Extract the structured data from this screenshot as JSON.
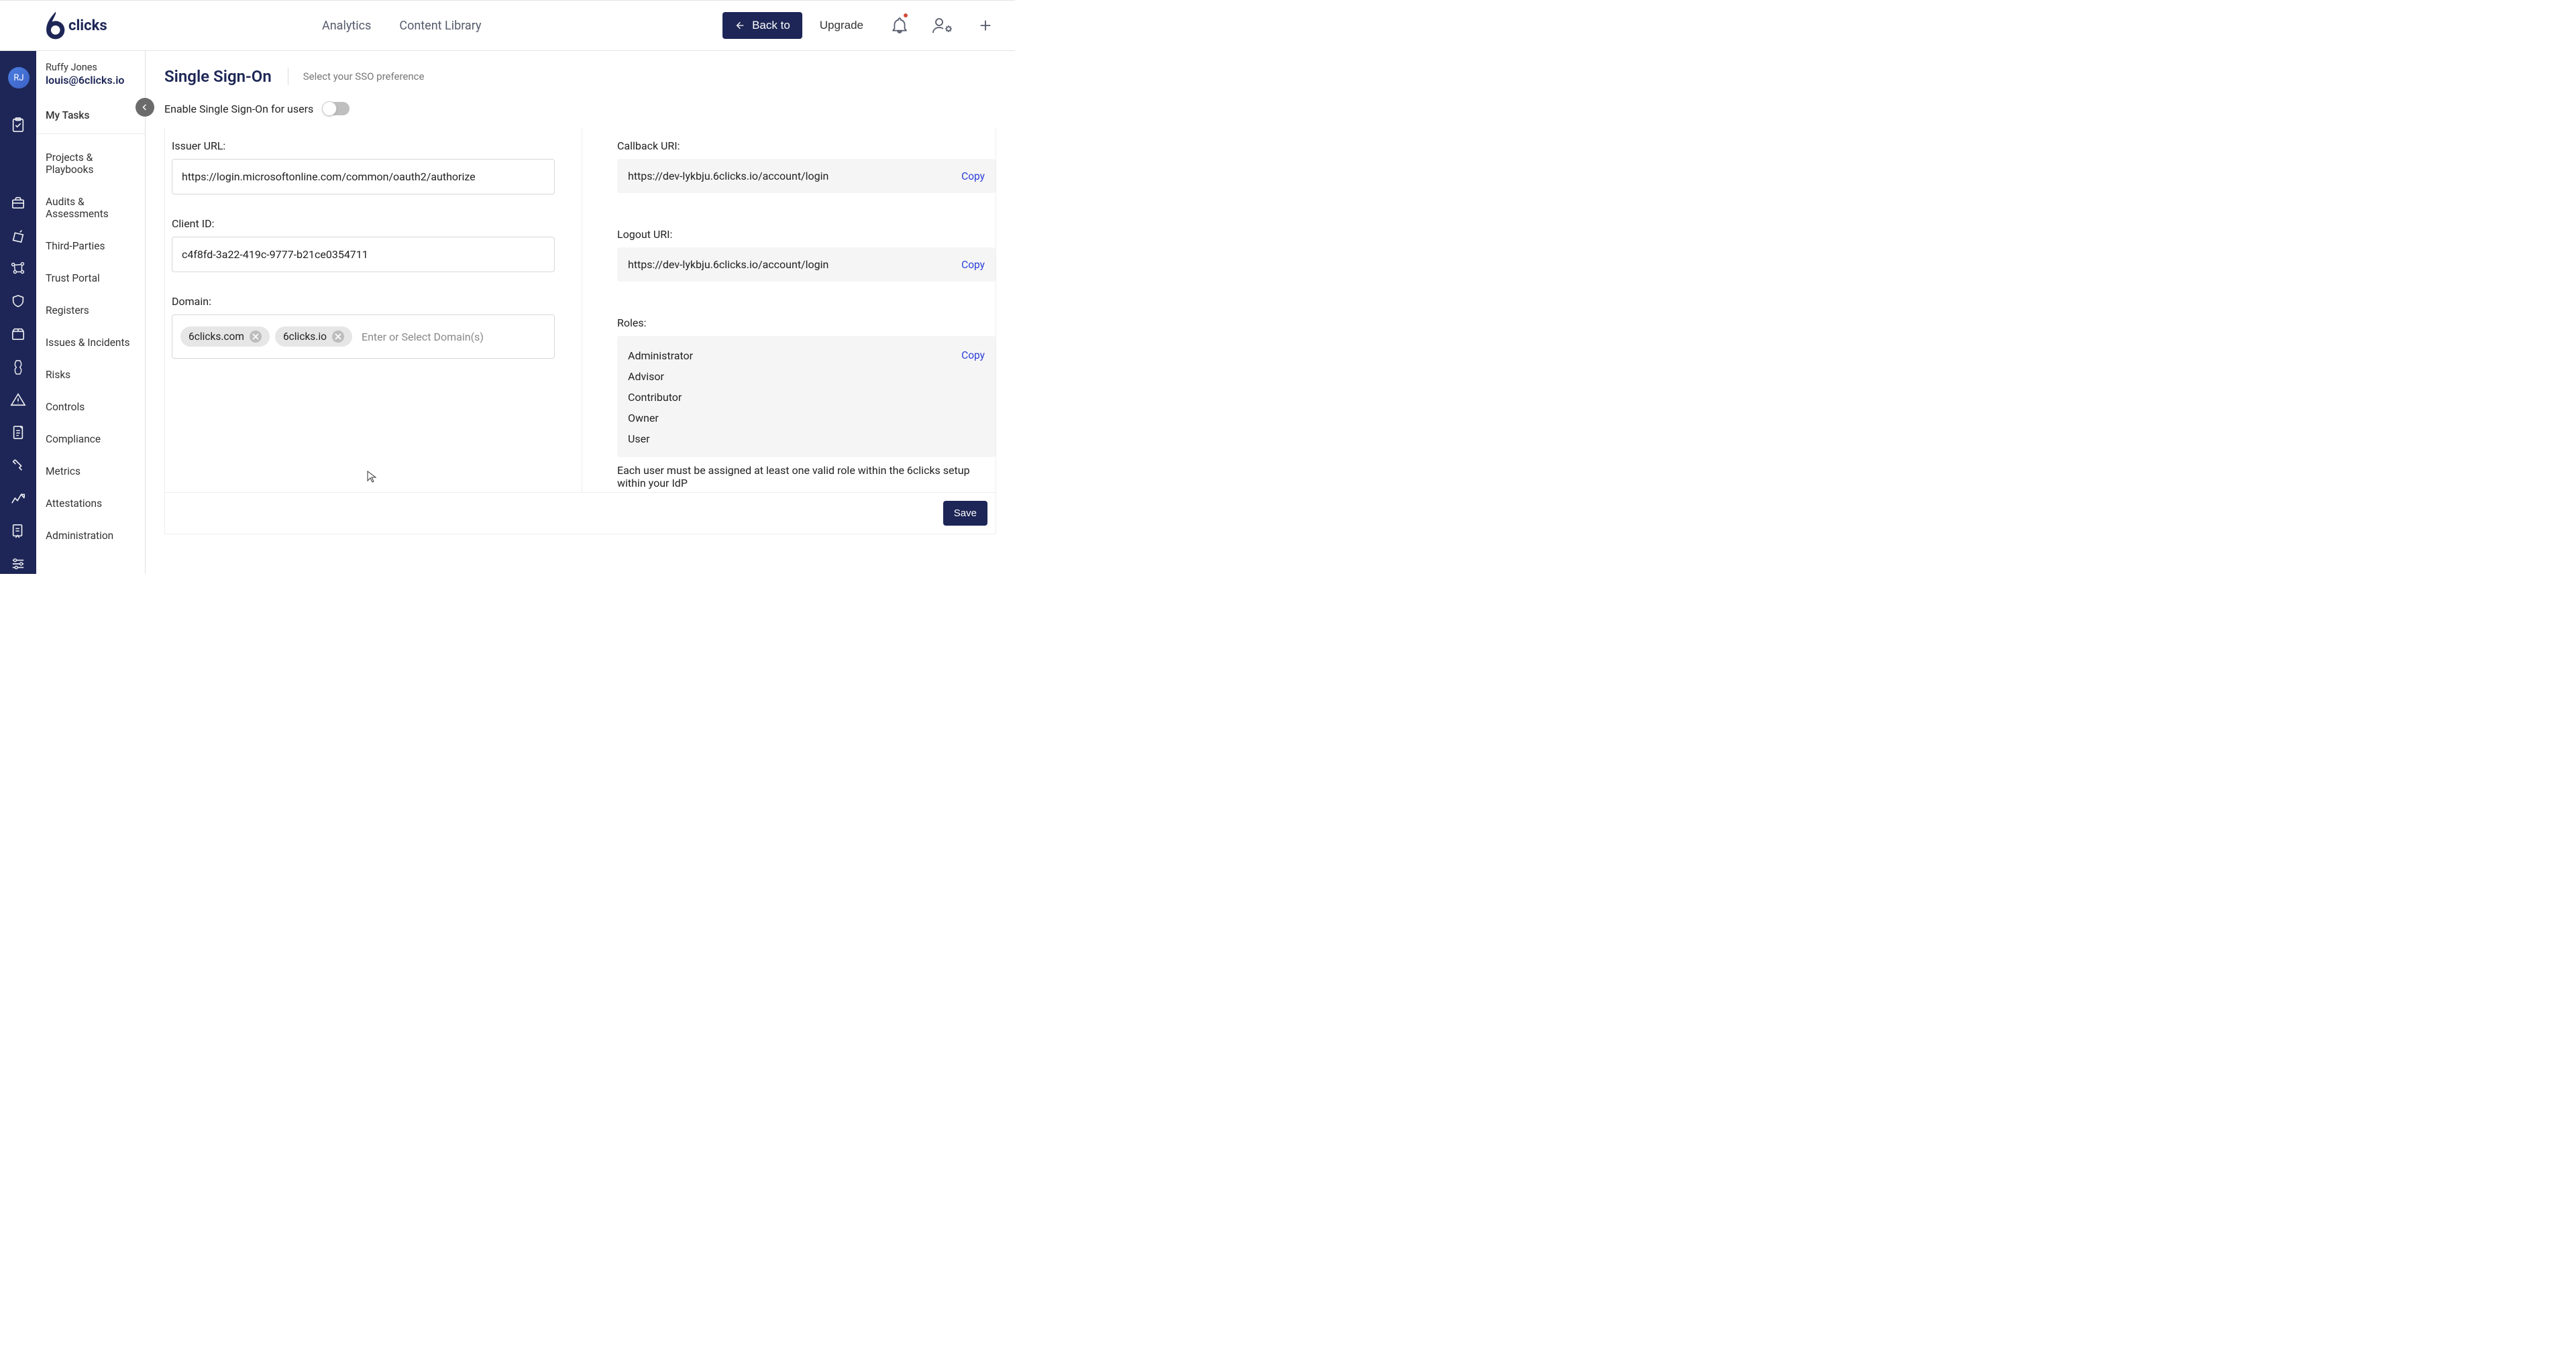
{
  "brand": "clicks",
  "topnav": {
    "analytics": "Analytics",
    "content_library": "Content Library"
  },
  "buttons": {
    "back": "Back to",
    "upgrade": "Upgrade",
    "save": "Save",
    "copy": "Copy"
  },
  "user": {
    "initials": "RJ",
    "name": "Ruffy Jones",
    "email": "louis@6clicks.io",
    "my_tasks": "My Tasks"
  },
  "nav": {
    "items": [
      "Projects & Playbooks",
      "Audits & Assessments",
      "Third-Parties",
      "Trust Portal",
      "Registers",
      "Issues & Incidents",
      "Risks",
      "Controls",
      "Compliance",
      "Metrics",
      "Attestations",
      "Administration"
    ]
  },
  "page": {
    "title": "Single Sign-On",
    "subtitle": "Select your SSO preference"
  },
  "enable_label": "Enable Single Sign-On for users",
  "left": {
    "issuer_label": "Issuer URL:",
    "issuer_value": "https://login.microsoftonline.com/common/oauth2/authorize",
    "client_label": "Client ID:",
    "client_value": "c4f8fd-3a22-419c-9777-b21ce0354711",
    "domain_label": "Domain:",
    "domain_tags": [
      "6clicks.com",
      "6clicks.io"
    ],
    "domain_placeholder": "Enter or Select Domain(s)"
  },
  "right": {
    "callback_label": "Callback URI:",
    "callback_value": "https://dev-lykbju.6clicks.io/account/login",
    "logout_label": "Logout URI:",
    "logout_value": "https://dev-lykbju.6clicks.io/account/login",
    "roles_label": "Roles:",
    "roles": [
      "Administrator",
      "Advisor",
      "Contributor",
      "Owner",
      "User"
    ],
    "roles_note": "Each user must be assigned at least one valid role within the 6clicks setup within your IdP"
  }
}
